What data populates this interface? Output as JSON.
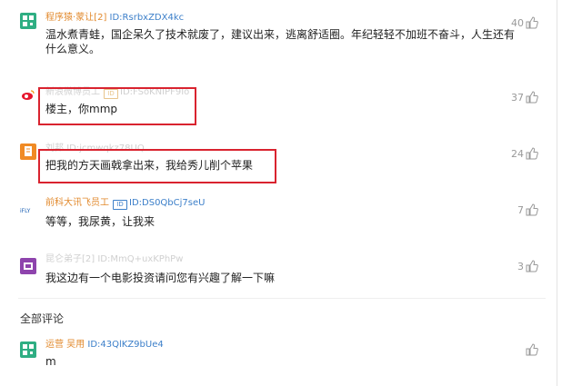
{
  "comments": [
    {
      "username": "程序猿·蒙让[2]",
      "user_id": "ID:RsrbxZDX4kc",
      "text_line1": "温水煮青蛙，国企呆久了技术就废了，建议出来，逃离舒适圈。年纪轻轻不加班不奋斗，人生还有",
      "text_line2": "什么意义。",
      "likes": "40",
      "avatar_icon": "qr-avatar-icon"
    },
    {
      "username": "新浪微博员工",
      "user_id": "ID:FSoKNIPF9Io",
      "text": "楼主，你mmp",
      "likes": "37",
      "avatar_icon": "weibo-logo-icon"
    },
    {
      "username": "刘邦",
      "user_id": "ID:jcmwqkz78UQ",
      "text": "把我的方天画戟拿出来，我给秀儿削个苹果",
      "likes": "24",
      "avatar_icon": "document-avatar-icon"
    },
    {
      "username": "前科大讯飞员工",
      "user_id": "ID:DS0QbCj7seU",
      "text": "等等，我尿黄，让我来",
      "likes": "7",
      "avatar_icon": "iflytek-logo-icon"
    },
    {
      "username": "昆仑弟子[2]",
      "user_id": "ID:MmQ+uxKPhPw",
      "text": "我这边有一个电影投资请问您有兴趣了解一下嘛",
      "likes": "3",
      "avatar_icon": "purple-avatar-icon"
    }
  ],
  "section_title": "全部评论",
  "all_comments": [
    {
      "username": "运营 吴用",
      "user_id": "ID:43QlKZ9bUe4",
      "text": "m",
      "likes": "",
      "avatar_icon": "qr-avatar-icon"
    }
  ],
  "colors": {
    "username": "#e28a2d",
    "user_id": "#3c7fc9",
    "highlight_box": "#d9232f"
  }
}
